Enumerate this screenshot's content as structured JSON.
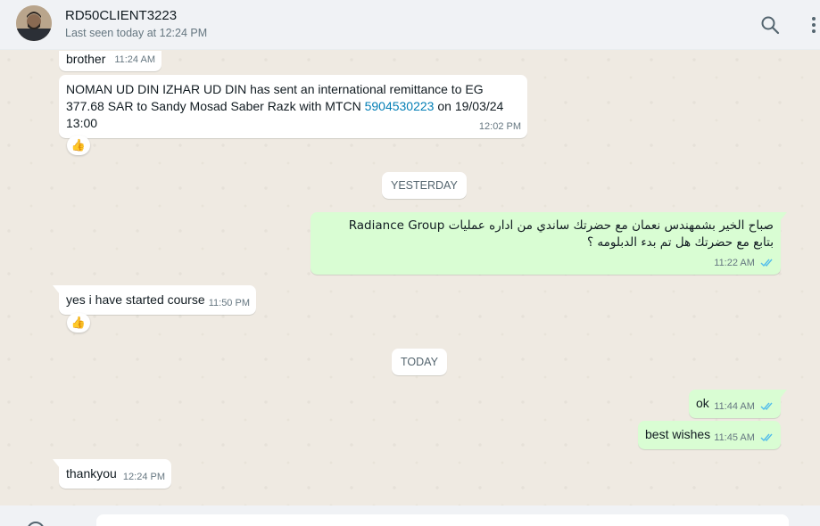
{
  "header": {
    "contact_name": "RD50CLIENT3223",
    "status": "Last seen today at 12:24 PM"
  },
  "messages": [
    {
      "direction": "in",
      "text": "brother",
      "time": "11:24 AM"
    },
    {
      "direction": "in",
      "text_prefix": "NOMAN UD DIN IZHAR UD DIN has sent an international remittance to EG\n377.68 SAR to Sandy Mosad Saber Razk with MTCN ",
      "link": "5904530223",
      "text_suffix": " on 19/03/24\n13:00",
      "time": "12:02 PM",
      "reaction": "👍"
    },
    {
      "direction": "out",
      "text": "صباح الخير بشمهندس نعمان مع حضرتك ساندي من اداره عمليات Radiance Group\nبتابع مع حضرتك هل تم بدء الدبلومه ؟",
      "time": "11:22 AM",
      "status": "read"
    },
    {
      "direction": "in",
      "text": "yes i have started course",
      "time": "11:50 PM",
      "reaction": "👍"
    },
    {
      "direction": "out",
      "text": "ok",
      "time": "11:44 AM",
      "status": "read"
    },
    {
      "direction": "out",
      "text": "best wishes",
      "time": "11:45 AM",
      "status": "read"
    },
    {
      "direction": "in",
      "text": "thankyou",
      "time": "12:24 PM"
    }
  ],
  "date_dividers": [
    "YESTERDAY",
    "TODAY"
  ],
  "icons": {
    "search": "search-icon",
    "menu": "kebab-menu-icon",
    "read_receipt": "double-check-icon",
    "reaction": "thumbs-up"
  },
  "colors": {
    "incoming_bubble": "#ffffff",
    "outgoing_bubble": "#d9fdd3",
    "chat_background": "#efeae2",
    "header_background": "#f0f2f5",
    "read_tick": "#53bdeb",
    "link": "#027eb5"
  }
}
